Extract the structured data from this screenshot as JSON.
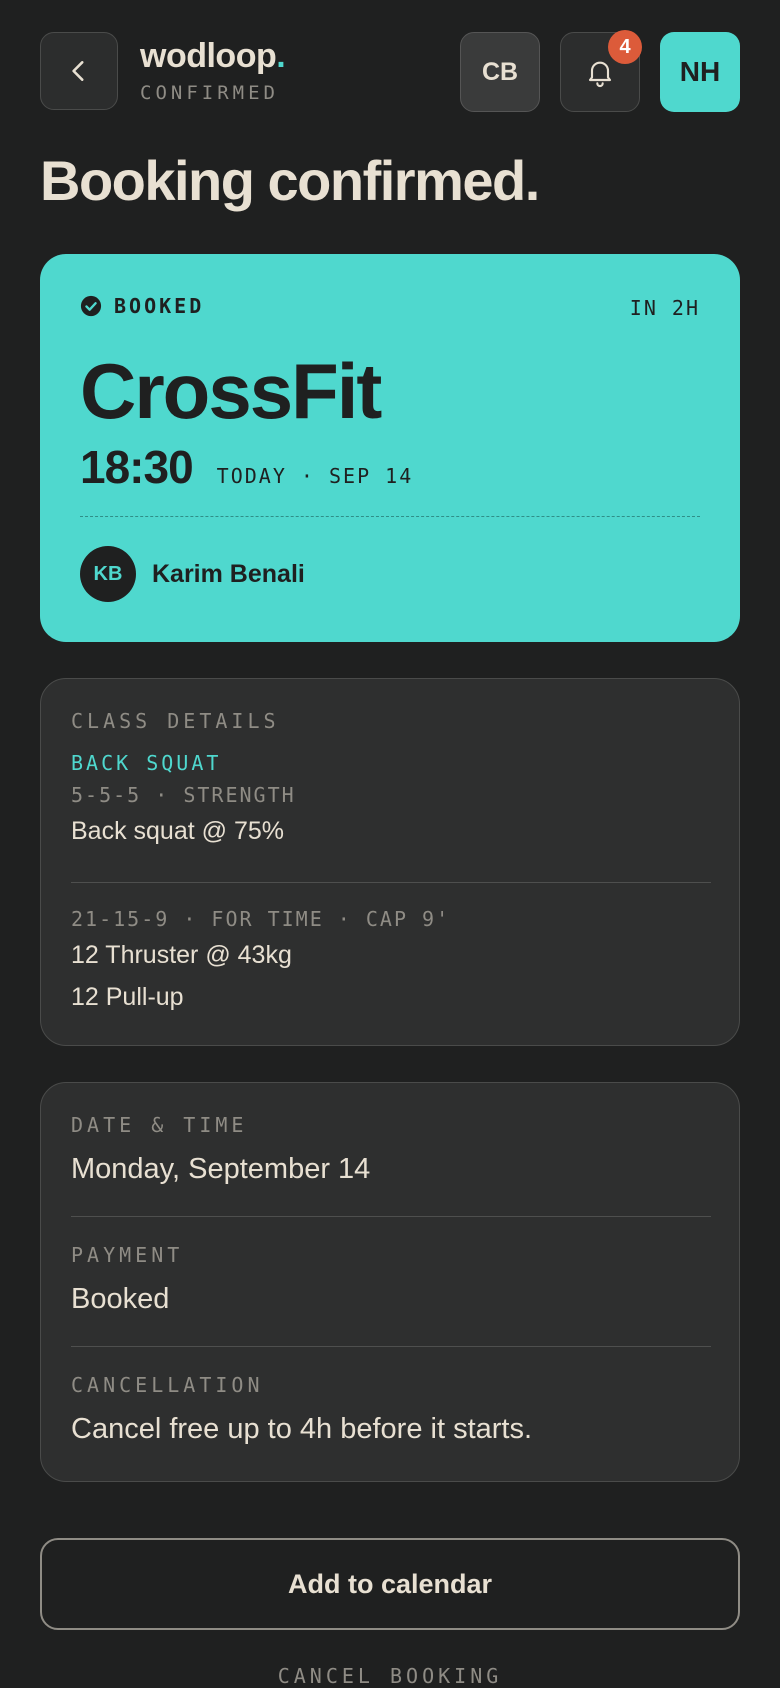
{
  "header": {
    "brand_name": "wodloop",
    "brand_dot": ".",
    "brand_subtitle": "CONFIRMED",
    "cb_label": "CB",
    "notification_count": "4",
    "user_initials": "NH"
  },
  "page_title": "Booking confirmed.",
  "booking": {
    "status": "BOOKED",
    "starts_in": "IN 2H",
    "class_name": "CrossFit",
    "time": "18:30",
    "date": "TODAY · SEP 14",
    "coach_initials": "KB",
    "coach_name": "Karim Benali"
  },
  "class_details": {
    "label": "CLASS DETAILS",
    "part1_title": "BACK SQUAT",
    "part1_scheme": "5-5-5 · STRENGTH",
    "part1_line": "Back squat @ 75%",
    "part2_scheme": "21-15-9 · FOR TIME · CAP 9'",
    "part2_lines": [
      "12 Thruster @ 43kg",
      "12 Pull-up"
    ]
  },
  "meta": {
    "date_label": "DATE & TIME",
    "date_value": "Monday, September 14",
    "payment_label": "PAYMENT",
    "payment_value": "Booked",
    "cancellation_label": "CANCELLATION",
    "cancellation_value": "Cancel free up to 4h before it starts."
  },
  "actions": {
    "add_to_calendar": "Add to calendar",
    "cancel_booking": "CANCEL BOOKING"
  },
  "colors": {
    "accent": "#4fd8ce",
    "background": "#1f2020",
    "badge": "#dc5b3a"
  },
  "icons": [
    "chevron-left-icon",
    "bell-icon",
    "check-circle-icon"
  ]
}
